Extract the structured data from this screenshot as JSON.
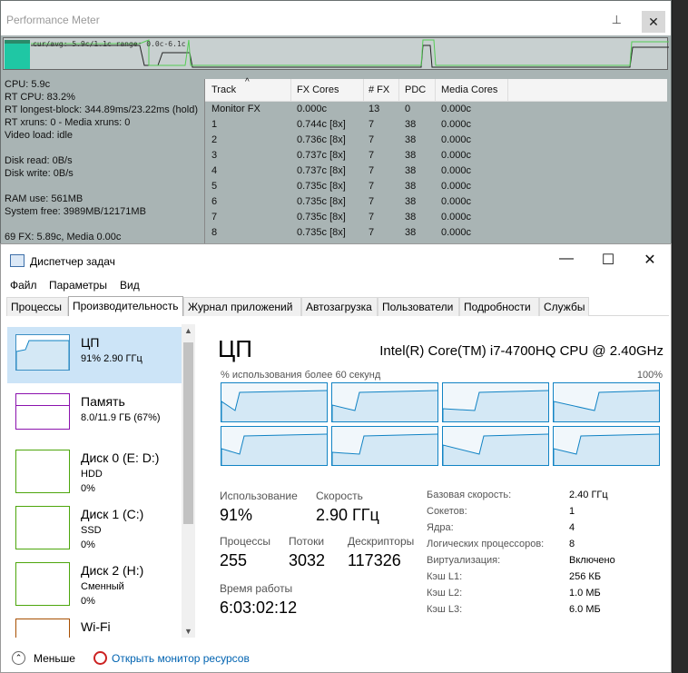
{
  "perf": {
    "title": "Performance Meter",
    "graph_caption": "cur/avg: 5.9c/1.1c  range: 0.0c-6.1c",
    "stats": [
      "CPU: 5.9c",
      "RT CPU: 83.2%",
      "RT longest-block: 344.89ms/23.22ms (hold)",
      "RT xruns: 0 - Media xruns: 0",
      "Video load: idle",
      "",
      "Disk read: 0B/s",
      "Disk write: 0B/s",
      "",
      "RAM use: 561MB",
      "System free: 3989MB/12171MB",
      "",
      "69 FX: 5.89c, Media 0.00c"
    ],
    "columns": [
      "Track",
      "FX Cores",
      "# FX",
      "PDC",
      "Media Cores"
    ],
    "rows": [
      [
        "Monitor FX",
        "0.000c",
        "13",
        "0",
        "0.000c"
      ],
      [
        "1",
        "0.744c [8x]",
        "7",
        "38",
        "0.000c"
      ],
      [
        "2",
        "0.736c [8x]",
        "7",
        "38",
        "0.000c"
      ],
      [
        "3",
        "0.737c [8x]",
        "7",
        "38",
        "0.000c"
      ],
      [
        "4",
        "0.737c [8x]",
        "7",
        "38",
        "0.000c"
      ],
      [
        "5",
        "0.735c [8x]",
        "7",
        "38",
        "0.000c"
      ],
      [
        "6",
        "0.735c [8x]",
        "7",
        "38",
        "0.000c"
      ],
      [
        "7",
        "0.735c [8x]",
        "7",
        "38",
        "0.000c"
      ],
      [
        "8",
        "0.735c [8x]",
        "7",
        "38",
        "0.000c"
      ]
    ]
  },
  "tm": {
    "title": "Диспетчер задач",
    "menu": [
      "Файл",
      "Параметры",
      "Вид"
    ],
    "tabs": [
      "Процессы",
      "Производительность",
      "Журнал приложений",
      "Автозагрузка",
      "Пользователи",
      "Подробности",
      "Службы"
    ],
    "side": [
      {
        "name": "ЦП",
        "sub1": "91% 2.90 ГГц",
        "sub2": ""
      },
      {
        "name": "Память",
        "sub1": "8.0/11.9 ГБ (67%)",
        "sub2": ""
      },
      {
        "name": "Диск 0 (E: D:)",
        "sub1": "HDD",
        "sub2": "0%"
      },
      {
        "name": "Диск 1 (C:)",
        "sub1": "SSD",
        "sub2": "0%"
      },
      {
        "name": "Диск 2 (H:)",
        "sub1": "Сменный",
        "sub2": "0%"
      },
      {
        "name": "Wi-Fi",
        "sub1": "",
        "sub2": ""
      }
    ],
    "cpu_title": "ЦП",
    "cpu_model": "Intel(R) Core(TM) i7-4700HQ CPU @ 2.40GHz",
    "graph_label": "% использования более 60 секунд",
    "graph_max": "100%",
    "usage_label": "Использование",
    "usage": "91%",
    "speed_label": "Скорость",
    "speed": "2.90 ГГц",
    "proc_label": "Процессы",
    "proc": "255",
    "threads_label": "Потоки",
    "threads": "3032",
    "handles_label": "Дескрипторы",
    "handles": "117326",
    "uptime_label": "Время работы",
    "uptime": "6:03:02:12",
    "specs": [
      [
        "Базовая скорость:",
        "2.40 ГГц"
      ],
      [
        "Сокетов:",
        "1"
      ],
      [
        "Ядра:",
        "4"
      ],
      [
        "Логических процессоров:",
        "8"
      ],
      [
        "Виртуализация:",
        "Включено"
      ],
      [
        "Кэш L1:",
        "256 КБ"
      ],
      [
        "Кэш L2:",
        "1.0 МБ"
      ],
      [
        "Кэш L3:",
        "6.0 МБ"
      ]
    ],
    "less": "Меньше",
    "resmon": "Открыть монитор ресурсов"
  }
}
